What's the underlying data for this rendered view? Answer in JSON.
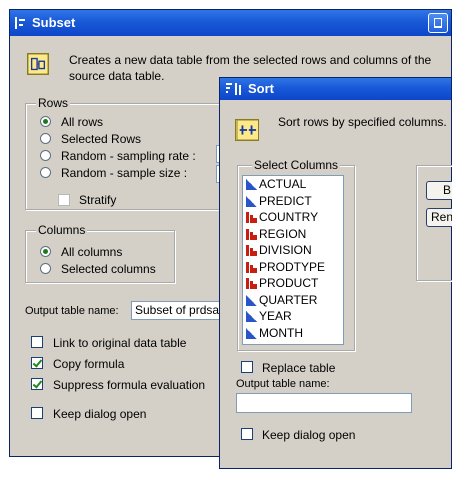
{
  "subset": {
    "title": "Subset",
    "description_line1": "Creates a new data table from the selected rows and columns of the",
    "description_line2": "source data table.",
    "rows_group": "Rows",
    "rows_options": [
      "All rows",
      "Selected Rows",
      "Random - sampling rate :",
      "Random - sample size :"
    ],
    "stratify": "Stratify",
    "columns_group": "Columns",
    "columns_options": [
      "All columns",
      "Selected columns"
    ],
    "output_label": "Output table name:",
    "output_value": "Subset of prdsa",
    "link_original": "Link to original data table",
    "copy_formula": "Copy formula",
    "suppress_formula": "Suppress formula evaluation",
    "keep_open": "Keep dialog open"
  },
  "sort": {
    "title": "Sort",
    "description": "Sort rows by specified columns.",
    "select_columns": "Select Columns",
    "columns": [
      {
        "name": "ACTUAL",
        "type": "continuous"
      },
      {
        "name": "PREDICT",
        "type": "continuous"
      },
      {
        "name": "COUNTRY",
        "type": "nominal"
      },
      {
        "name": "REGION",
        "type": "nominal"
      },
      {
        "name": "DIVISION",
        "type": "nominal"
      },
      {
        "name": "PRODTYPE",
        "type": "nominal"
      },
      {
        "name": "PRODUCT",
        "type": "nominal"
      },
      {
        "name": "QUARTER",
        "type": "continuous"
      },
      {
        "name": "YEAR",
        "type": "continuous"
      },
      {
        "name": "MONTH",
        "type": "continuous"
      }
    ],
    "by_button": "B",
    "remove_button": "Ren",
    "replace_table": "Replace table",
    "output_label": "Output table name:",
    "output_value": "",
    "keep_open": "Keep dialog open"
  },
  "colors": {
    "title_bar": "#1959d8",
    "dialog_bg": "#d4d0c8",
    "nominal_icon": "#c81e10",
    "continuous_icon": "#2a55c8"
  }
}
